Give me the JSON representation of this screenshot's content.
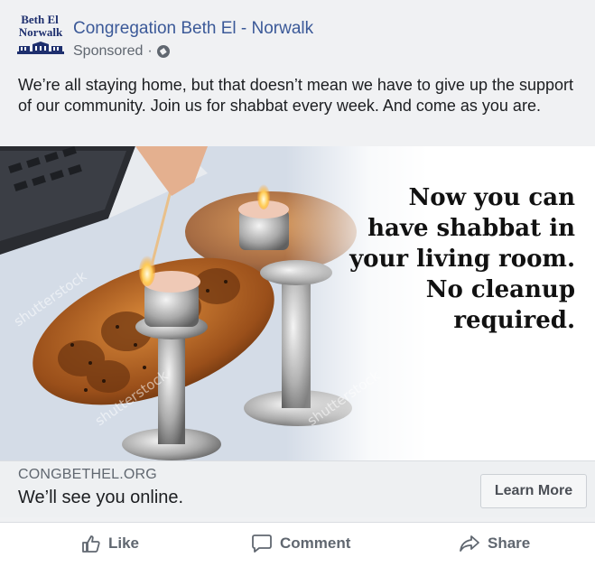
{
  "header": {
    "logo_line1": "Beth El",
    "logo_line2": "Norwalk",
    "page_name": "Congregation Beth El - Norwalk",
    "sponsored": "Sponsored",
    "separator": "·",
    "globe_icon": "globe-icon"
  },
  "post": {
    "text": "We’re all staying home, but that doesn’t mean we have to give up the support of our community. Join us for shabbat every week. And come as you are."
  },
  "media": {
    "overlay_lines": [
      "Now you can",
      "have shabbat in",
      "your living room.",
      "No cleanup",
      "required."
    ],
    "watermark": "shutterstock"
  },
  "link": {
    "domain": "CONGBETHEL.ORG",
    "headline": "We’ll see you online.",
    "cta_label": "Learn More"
  },
  "actions": {
    "like": "Like",
    "comment": "Comment",
    "share": "Share"
  },
  "colors": {
    "page_name": "#3b5998",
    "secondary_text": "#606770",
    "background": "#f0f1f3"
  }
}
